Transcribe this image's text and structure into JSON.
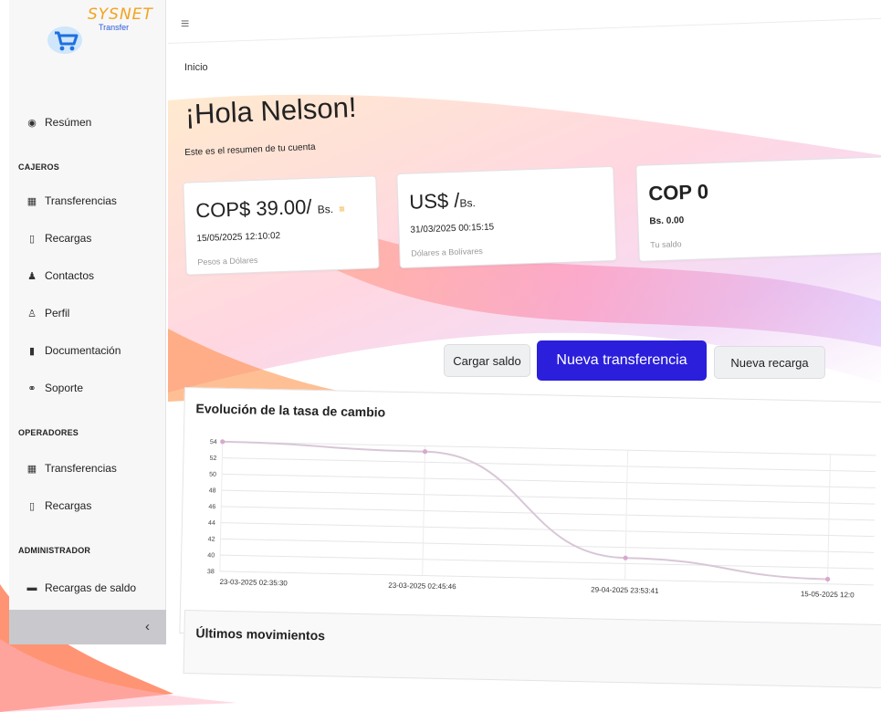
{
  "brand": {
    "name": "SYSNET",
    "sub": "Transfer"
  },
  "sidebar": {
    "summary": "Resúmen",
    "sections": [
      {
        "title": "CAJEROS",
        "items": [
          "Transferencias",
          "Recargas",
          "Contactos",
          "Perfil",
          "Documentación",
          "Soporte"
        ]
      },
      {
        "title": "OPERADORES",
        "items": [
          "Transferencias",
          "Recargas"
        ]
      },
      {
        "title": "ADMINISTRADOR",
        "items": [
          "Recargas de saldo"
        ]
      }
    ],
    "collapse_icon": "chevron-left-icon"
  },
  "breadcrumb": "Inicio",
  "greeting": {
    "title": "¡Hola Nelson!",
    "subtitle": "Este es el resumen de tu cuenta"
  },
  "cards": [
    {
      "value": "COP$ 39.00/",
      "unit": "Bs.",
      "date": "15/05/2025 12:10:02",
      "note": "Pesos a Dólares"
    },
    {
      "value": "US$ /",
      "unit": "Bs.",
      "date": "31/03/2025 00:15:15",
      "note": "Dólares a Bolívares"
    },
    {
      "value": "COP 0",
      "unit": "",
      "date": "Bs. 0.00",
      "note": "Tu saldo"
    }
  ],
  "buttons": {
    "cargar": "Cargar saldo",
    "nueva_transferencia": "Nueva transferencia",
    "nueva_recarga": "Nueva recarga"
  },
  "chart_panel_title": "Evolución de la tasa de cambio",
  "movements_title": "Últimos movimientos",
  "colors": {
    "primary": "#2b1fdc",
    "accent": "#f2a31b",
    "line": "#d8c7d6"
  },
  "chart_data": {
    "type": "line",
    "categories": [
      "23-03-2025 02:35:30",
      "23-03-2025 02:45:46",
      "29-04-2025 23:53:41",
      "15-05-2025 12:0"
    ],
    "series": [
      {
        "values": [
          54,
          53.3,
          40.7,
          38.6
        ]
      }
    ],
    "yticks": [
      54,
      52,
      50,
      48,
      46,
      44,
      42,
      40,
      38
    ],
    "ylim": [
      38,
      54
    ],
    "grid": true
  }
}
